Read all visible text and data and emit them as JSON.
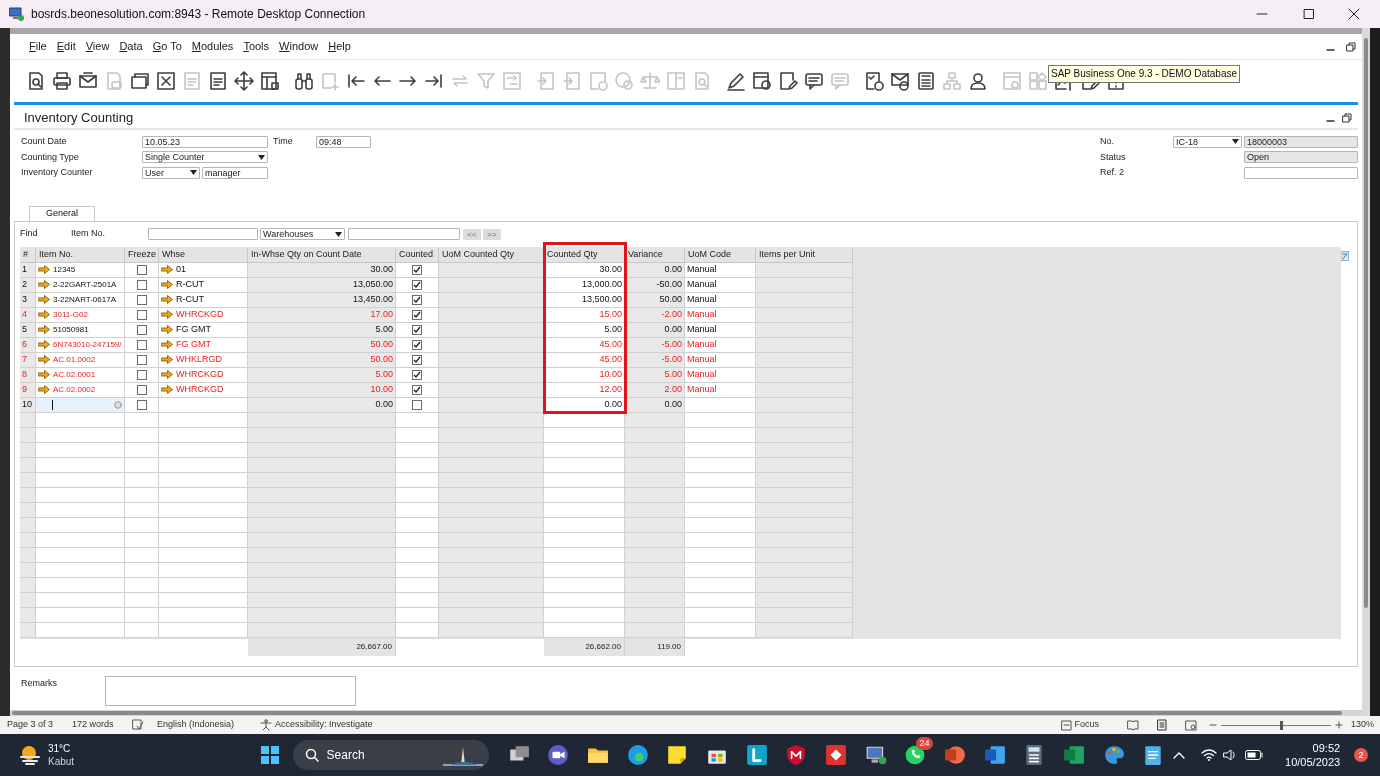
{
  "window": {
    "title": "bosrds.beonesolution.com:8943 - Remote Desktop Connection"
  },
  "menu": [
    "File",
    "Edit",
    "View",
    "Data",
    "Go To",
    "Modules",
    "Tools",
    "Window",
    "Help"
  ],
  "toolbar": [
    {
      "disabled": false
    },
    {
      "disabled": false
    },
    {
      "disabled": false
    },
    {
      "disabled": true
    },
    {
      "disabled": false
    },
    {
      "disabled": false
    },
    {
      "disabled": true
    },
    {
      "disabled": false
    },
    {
      "disabled": false
    },
    {
      "disabled": false
    },
    {
      "disabled": false
    },
    {
      "disabled": true
    },
    {
      "disabled": false
    },
    {
      "disabled": false
    },
    {
      "disabled": false
    },
    {
      "disabled": false
    },
    {
      "disabled": true
    },
    {
      "disabled": true
    },
    {
      "disabled": true
    },
    {
      "disabled": true
    },
    {
      "disabled": true
    },
    {
      "disabled": true
    },
    {
      "disabled": true
    },
    {
      "disabled": true
    },
    {
      "disabled": true
    },
    {
      "disabled": true
    },
    {
      "disabled": false
    },
    {
      "disabled": false
    },
    {
      "disabled": false
    },
    {
      "disabled": false
    },
    {
      "disabled": true
    },
    {
      "disabled": false
    },
    {
      "disabled": false
    },
    {
      "disabled": false
    },
    {
      "disabled": true
    },
    {
      "disabled": false
    },
    {
      "disabled": true
    },
    {
      "disabled": true
    },
    {
      "disabled": false
    },
    {
      "disabled": false
    },
    {
      "disabled": false
    }
  ],
  "tooltip": "SAP Business One 9.3 - DEMO Database",
  "form": {
    "title": "Inventory Counting"
  },
  "header": {
    "count_date": {
      "label": "Count Date",
      "value": "10.05.23"
    },
    "time": {
      "label": "Time",
      "value": "09:48"
    },
    "counting_type": {
      "label": "Counting Type",
      "value": "Single Counter"
    },
    "inventory_counter": {
      "label": "Inventory Counter",
      "type": "User",
      "value": "manager"
    },
    "no": {
      "label": "No.",
      "series": "IC-18",
      "value": "18000003"
    },
    "status": {
      "label": "Status",
      "value": "Open"
    },
    "ref2": {
      "label": "Ref. 2"
    }
  },
  "tabs": [
    {
      "label": "General",
      "selected": true
    }
  ],
  "find": {
    "label": "Find",
    "field_label": "Item No.",
    "filter": "Warehouses",
    "prev": "<<",
    "next": ">>",
    "nav_disabled": true
  },
  "table": {
    "columns": [
      "#",
      "Item No.",
      "Freeze",
      "Whse",
      "In-Whse Qty on Count Date",
      "Counted",
      "UoM Counted Qty",
      "Counted Qty",
      "Variance",
      "UoM Code",
      "Items per Unit"
    ],
    "rows": [
      {
        "num": "1",
        "item": "12345",
        "freeze": false,
        "whse": "01",
        "in_whse": "30.00",
        "counted": true,
        "counted_qty": "30.00",
        "variance": "0.00",
        "uom_code": "Manual",
        "flagged": false,
        "editing": false
      },
      {
        "num": "2",
        "item": "2-22GART-2501A",
        "freeze": false,
        "whse": "R-CUT",
        "in_whse": "13,050.00",
        "counted": true,
        "counted_qty": "13,000.00",
        "variance": "-50.00",
        "uom_code": "Manual",
        "flagged": false,
        "editing": false
      },
      {
        "num": "3",
        "item": "3-22NART-0617A",
        "freeze": false,
        "whse": "R-CUT",
        "in_whse": "13,450.00",
        "counted": true,
        "counted_qty": "13,500.00",
        "variance": "50.00",
        "uom_code": "Manual",
        "flagged": false,
        "editing": false
      },
      {
        "num": "4",
        "item": "3011-G02",
        "freeze": false,
        "whse": "WHRCKGD",
        "in_whse": "17.00",
        "counted": true,
        "counted_qty": "15.00",
        "variance": "-2.00",
        "uom_code": "Manual",
        "flagged": true,
        "editing": false
      },
      {
        "num": "5",
        "item": "51050981",
        "freeze": false,
        "whse": "FG GMT",
        "in_whse": "5.00",
        "counted": true,
        "counted_qty": "5.00",
        "variance": "0.00",
        "uom_code": "Manual",
        "flagged": false,
        "editing": false
      },
      {
        "num": "6",
        "item": "6N743010-247159/",
        "freeze": false,
        "whse": "FG GMT",
        "in_whse": "50.00",
        "counted": true,
        "counted_qty": "45.00",
        "variance": "-5.00",
        "uom_code": "Manual",
        "flagged": true,
        "editing": false
      },
      {
        "num": "7",
        "item": "AC.01.0002",
        "freeze": false,
        "whse": "WHKLRGD",
        "in_whse": "50.00",
        "counted": true,
        "counted_qty": "45.00",
        "variance": "-5.00",
        "uom_code": "Manual",
        "flagged": true,
        "editing": false
      },
      {
        "num": "8",
        "item": "AC.02.0001",
        "freeze": false,
        "whse": "WHRCKGD",
        "in_whse": "5.00",
        "counted": true,
        "counted_qty": "10.00",
        "variance": "5.00",
        "uom_code": "Manual",
        "flagged": true,
        "editing": false
      },
      {
        "num": "9",
        "item": "AC.02.0002",
        "freeze": false,
        "whse": "WHRCKGD",
        "in_whse": "10.00",
        "counted": true,
        "counted_qty": "12.00",
        "variance": "2.00",
        "uom_code": "Manual",
        "flagged": true,
        "editing": false
      },
      {
        "num": "10",
        "freeze": false,
        "in_whse": "0.00",
        "counted": false,
        "counted_qty": "0.00",
        "variance": "0.00",
        "flagged": false,
        "editing": true
      }
    ],
    "totals": {
      "in_whse": "26,667.00",
      "counted_qty": "26,662.00",
      "variance": "119.00"
    }
  },
  "remarks": {
    "label": "Remarks"
  },
  "status_bar": {
    "page": "Page 3 of 3",
    "words": "172 words",
    "language": "English (Indonesia)",
    "accessibility": "Accessibility: Investigate",
    "focus": "Focus",
    "zoom": "130%",
    "zoom_level": {
      "level": 0.55
    }
  },
  "taskbar": {
    "weather": {
      "temp": "31°C",
      "condition": "Kabut"
    },
    "search": "Search",
    "chat_badge": "24",
    "clock": {
      "time": "09:52",
      "date": "10/05/2023"
    },
    "notifications": "2"
  }
}
